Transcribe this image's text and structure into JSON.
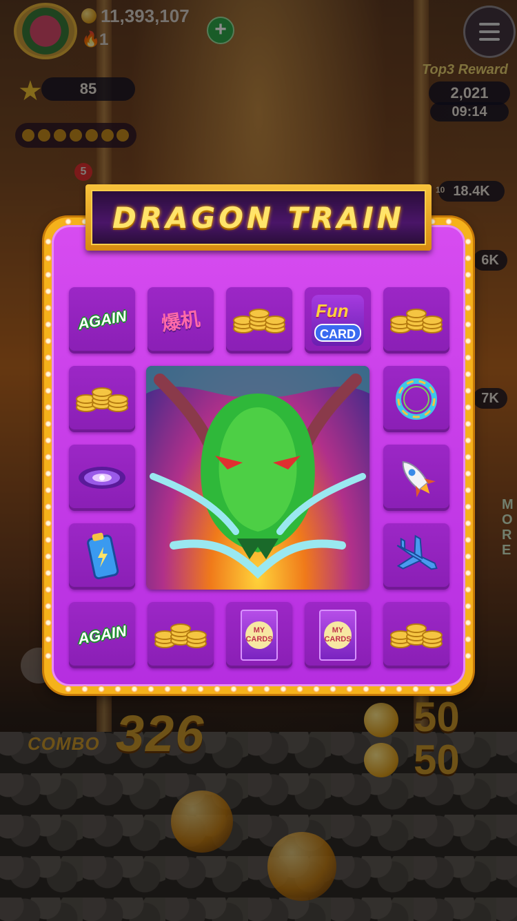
{
  "hud": {
    "coins": "11,393,107",
    "fire_count": "1",
    "stars": "85",
    "top3_reward_label": "Top3 Reward",
    "reward_amount": "2,021",
    "timer": "09:14",
    "notification_count": "5",
    "rank_badge": "10",
    "side_value_1": "18.4K",
    "side_value_2": "6K",
    "side_value_3": "7K",
    "more_label": "MORE"
  },
  "modal": {
    "title": "DRAGON TRAIN",
    "again_label": "AGAIN",
    "boom_label": "爆机",
    "fun_label": "Fun",
    "card_label": "CARD",
    "my_cards_label": "MY CARDS"
  },
  "bottom": {
    "combo_label": "COMBO",
    "combo_value": "326",
    "payout_1": "50",
    "payout_2": "50"
  },
  "icons": {
    "coins": "coin-stack-icon",
    "rings": "dragon-ring-icon",
    "galaxy": "galaxy-icon",
    "rocket": "rocket-icon",
    "battery": "battery-icon",
    "plane": "airplane-icon"
  },
  "colors": {
    "panel_purple": "#b52ee0",
    "frame_gold": "#f5b21b",
    "title_yellow": "#ffe46a"
  }
}
